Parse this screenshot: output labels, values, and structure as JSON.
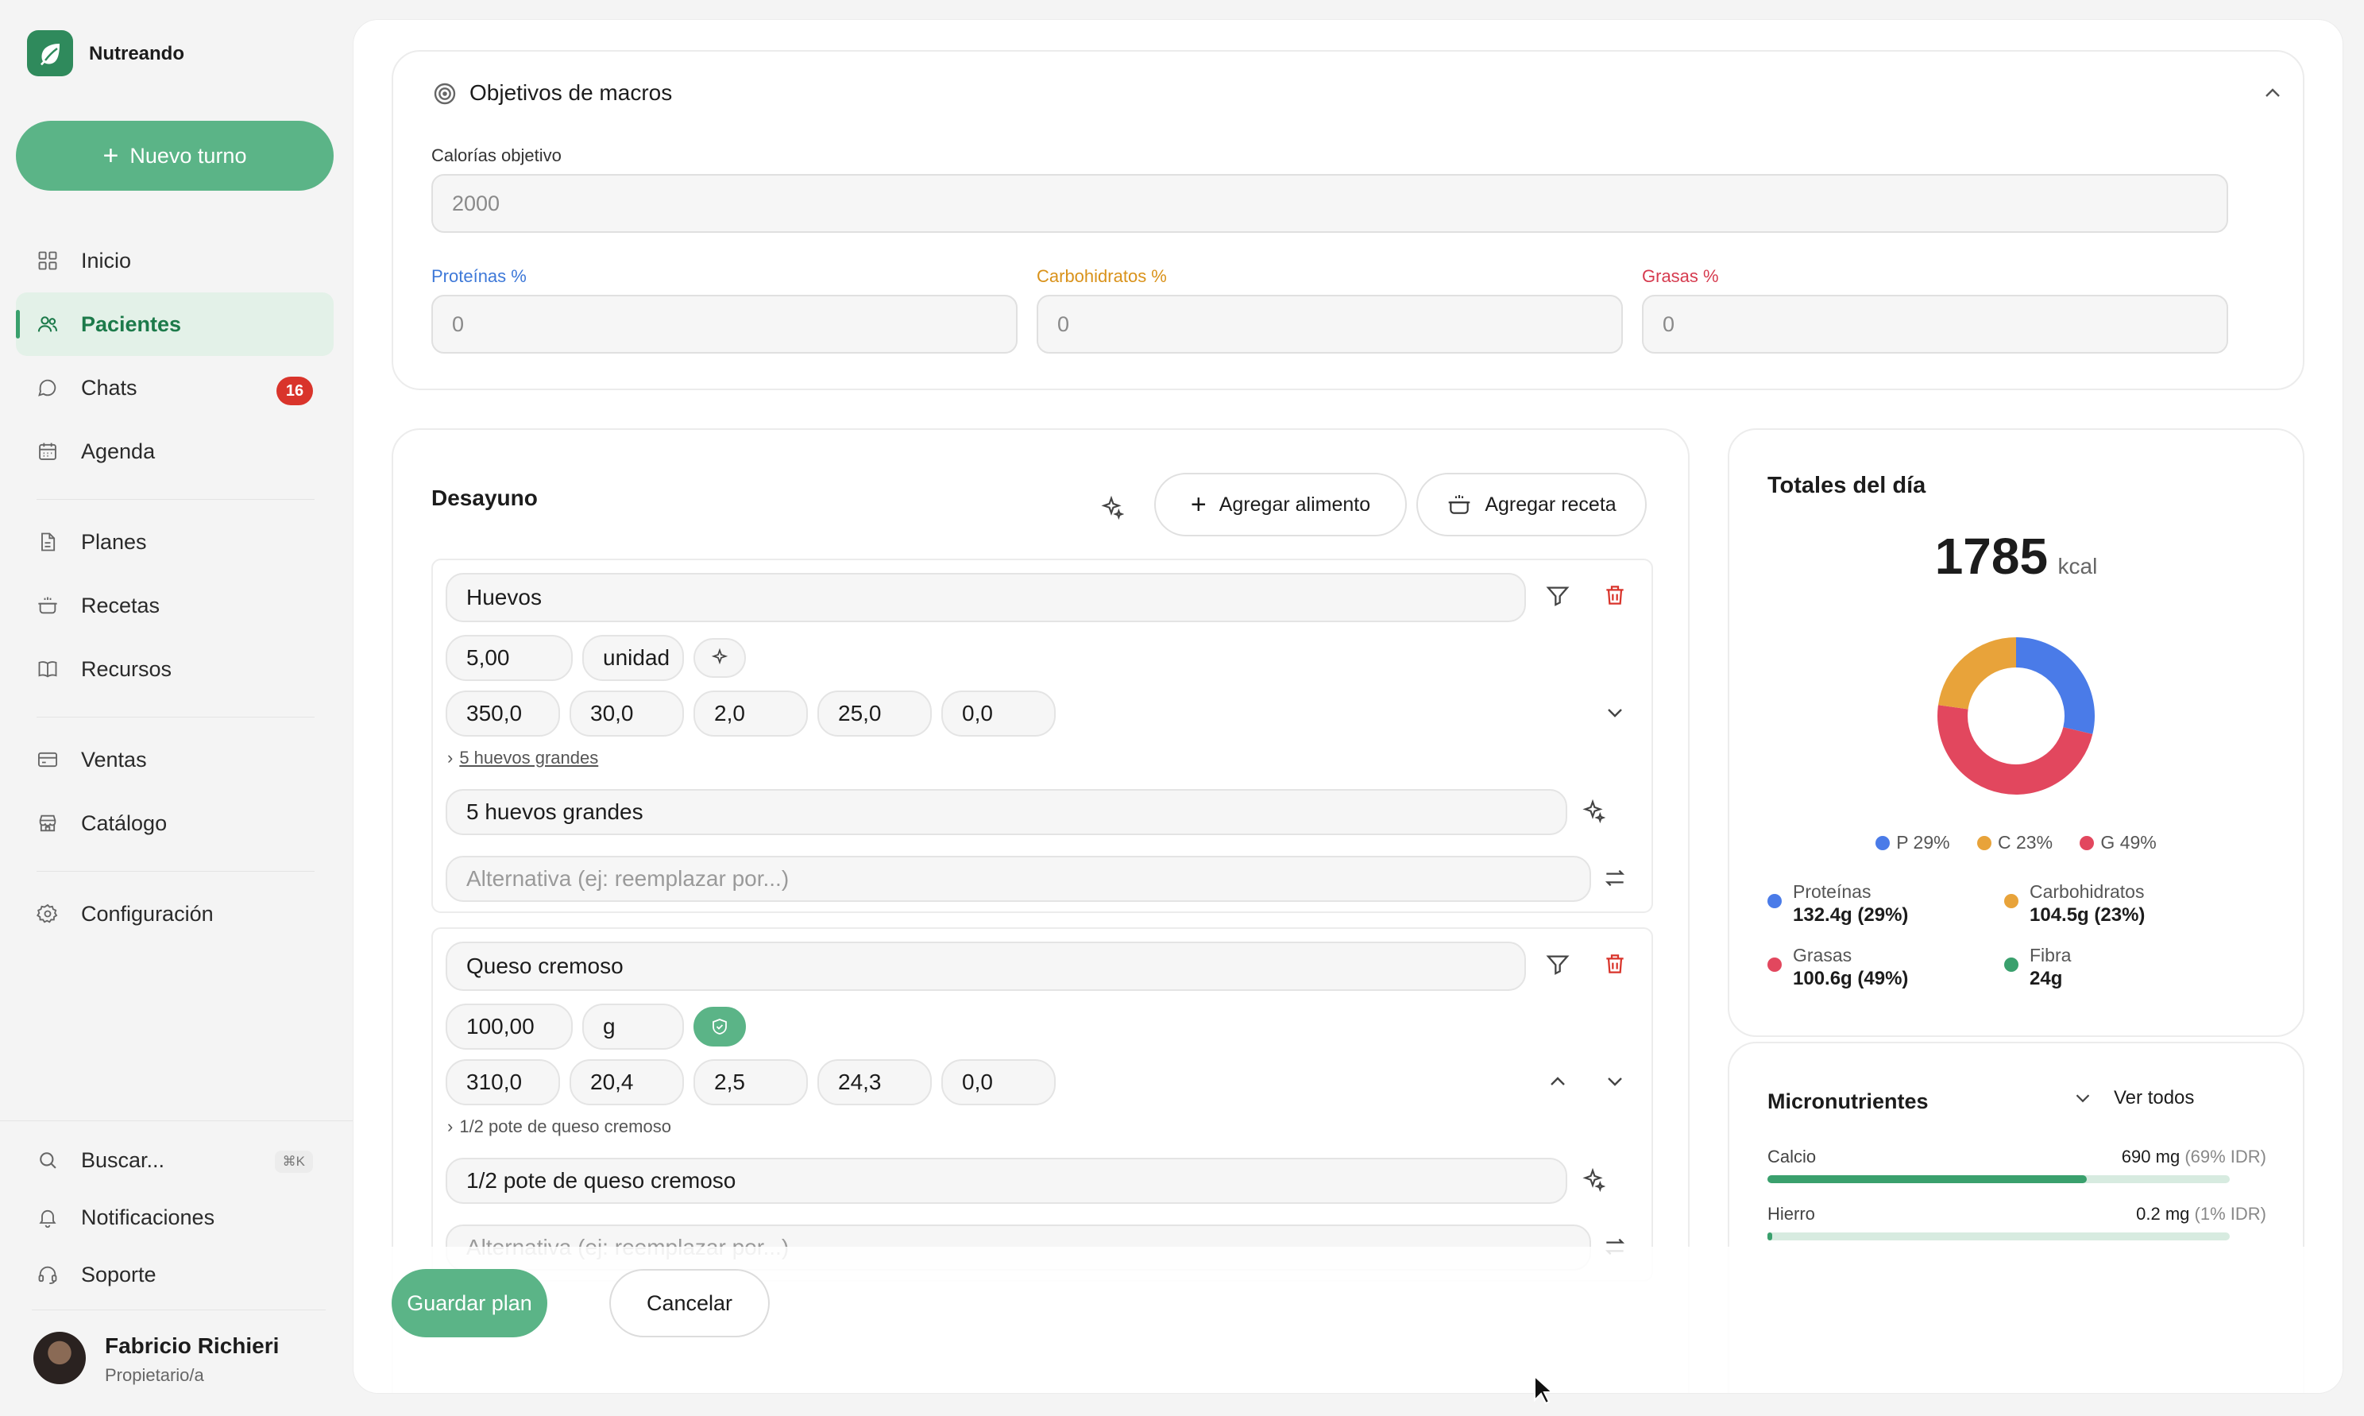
{
  "brand": {
    "name": "Nutreando"
  },
  "sidebar": {
    "new_button": "Nuevo turno",
    "items": [
      {
        "label": "Inicio",
        "icon": "grid-icon"
      },
      {
        "label": "Pacientes",
        "icon": "users-icon",
        "active": true
      },
      {
        "label": "Chats",
        "icon": "chat-icon",
        "badge": "16"
      },
      {
        "label": "Agenda",
        "icon": "calendar-icon"
      },
      {
        "label": "Planes",
        "icon": "file-icon"
      },
      {
        "label": "Recetas",
        "icon": "pot-icon"
      },
      {
        "label": "Recursos",
        "icon": "book-icon"
      },
      {
        "label": "Ventas",
        "icon": "card-icon"
      },
      {
        "label": "Catálogo",
        "icon": "store-icon"
      },
      {
        "label": "Configuración",
        "icon": "gear-icon"
      }
    ],
    "bottom": {
      "search": "Buscar...",
      "search_shortcut": "⌘K",
      "notifications": "Notificaciones",
      "support": "Soporte"
    },
    "user": {
      "name": "Fabricio Richieri",
      "role": "Propietario/a"
    }
  },
  "macros": {
    "title": "Objetivos de macros",
    "calories_label": "Calorías objetivo",
    "calories_placeholder": "2000",
    "protein_label": "Proteínas %",
    "carbs_label": "Carbohidratos %",
    "fat_label": "Grasas %",
    "protein_placeholder": "0",
    "carbs_placeholder": "0",
    "fat_placeholder": "0"
  },
  "meal": {
    "title": "Desayuno",
    "add_food": "Agregar alimento",
    "add_recipe": "Agregar receta",
    "foods": [
      {
        "name": "Huevos",
        "quantity": "5,00",
        "unit": "unidad",
        "kcal": "350,0",
        "protein": "30,0",
        "carbs": "2,0",
        "fat": "25,0",
        "fiber": "0,0",
        "portion_link": "5 huevos grandes",
        "description": "5 huevos grandes",
        "alternative_placeholder": "Alternativa (ej: reemplazar por...)"
      },
      {
        "name": "Queso cremoso",
        "quantity": "100,00",
        "unit": "g",
        "kcal": "310,0",
        "protein": "20,4",
        "carbs": "2,5",
        "fat": "24,3",
        "fiber": "0,0",
        "portion_link": "1/2 pote de queso cremoso",
        "description": "1/2 pote de queso cremoso",
        "alternative_placeholder": "Alternativa (ej: reemplazar por...)"
      }
    ]
  },
  "totals": {
    "title": "Totales del día",
    "kcal": "1785",
    "kcal_unit": "kcal",
    "legend": [
      {
        "label": "P 29%",
        "color": "#4a7be8"
      },
      {
        "label": "C 23%",
        "color": "#e8a33a"
      },
      {
        "label": "G 49%",
        "color": "#e2475e"
      }
    ],
    "breakdown": [
      {
        "name": "Proteínas",
        "value": "132.4g (29%)",
        "color": "#4a7be8"
      },
      {
        "name": "Carbohidratos",
        "value": "104.5g (23%)",
        "color": "#e8a33a"
      },
      {
        "name": "Grasas",
        "value": "100.6g (49%)",
        "color": "#e2475e"
      },
      {
        "name": "Fibra",
        "value": "24g",
        "color": "#3aa06d"
      }
    ]
  },
  "chart_data": {
    "type": "pie",
    "categories": [
      "P",
      "C",
      "G"
    ],
    "values": [
      29,
      23,
      49
    ]
  },
  "micros": {
    "title": "Micronutrientes",
    "view_all": "Ver todos",
    "items": [
      {
        "name": "Calcio",
        "amount": "690 mg",
        "idr": "(69% IDR)",
        "fraction": 0.69
      },
      {
        "name": "Hierro",
        "amount": "0.2 mg",
        "idr": "(1% IDR)",
        "fraction": 0.01
      }
    ]
  },
  "actions": {
    "save": "Guardar plan",
    "cancel": "Cancelar"
  }
}
